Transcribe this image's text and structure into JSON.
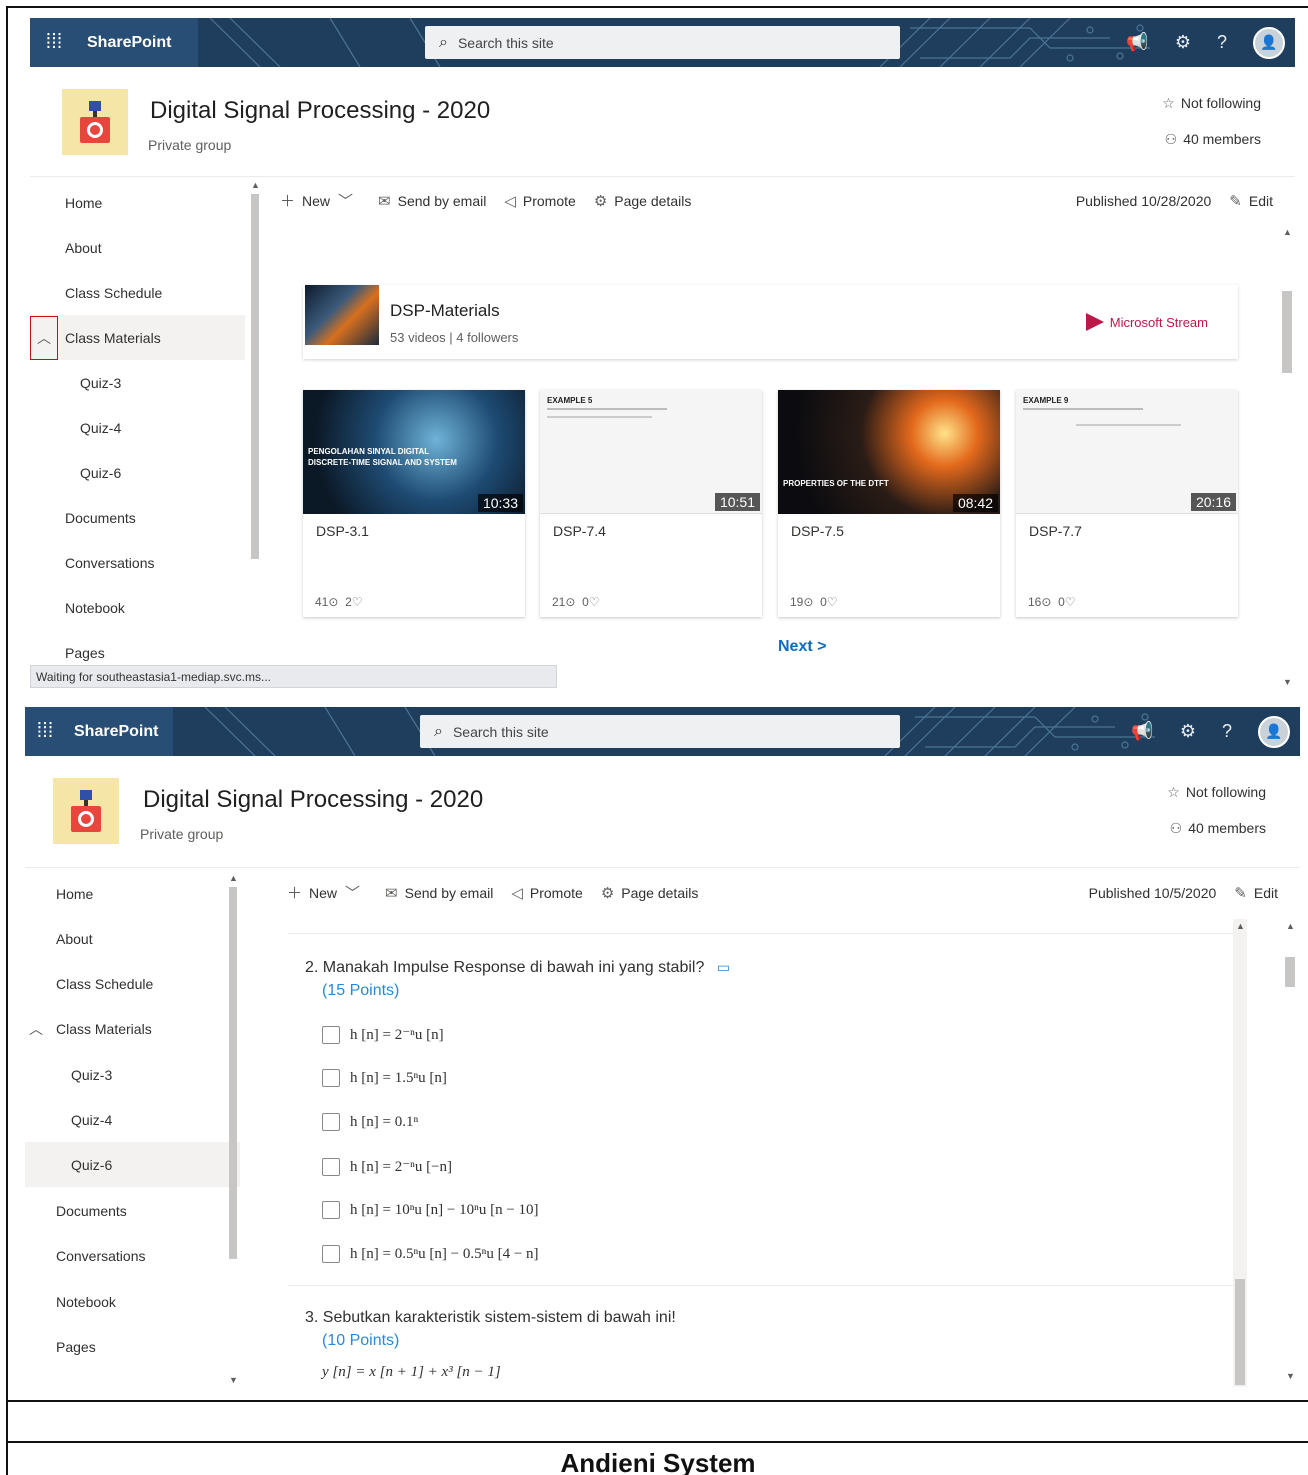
{
  "suite": {
    "brand": "SharePoint",
    "search_placeholder": "Search this site"
  },
  "site": {
    "title": "Digital Signal Processing - 2020",
    "subtitle": "Private group",
    "follow": "Not following",
    "members": "40 members"
  },
  "nav": {
    "home": "Home",
    "about": "About",
    "schedule": "Class Schedule",
    "materials": "Class Materials",
    "quiz3": "Quiz-3",
    "quiz4": "Quiz-4",
    "quiz6": "Quiz-6",
    "documents": "Documents",
    "conversations": "Conversations",
    "notebook": "Notebook",
    "pages": "Pages"
  },
  "cmd": {
    "new": "New",
    "send": "Send by email",
    "promote": "Promote",
    "details": "Page details",
    "edit": "Edit"
  },
  "screen1": {
    "published": "Published 10/28/2020",
    "stream": {
      "name": "DSP-Materials",
      "meta": "53 videos | 4 followers",
      "brand": "Microsoft Stream"
    },
    "videos": [
      {
        "title": "DSP-3.1",
        "duration": "10:33",
        "views": "41",
        "likes": "2",
        "thumb_text_1": "PENGOLAHAN SINYAL DIGITAL",
        "thumb_text_2": "DISCRETE-TIME SIGNAL AND SYSTEM"
      },
      {
        "title": "DSP-7.4",
        "duration": "10:51",
        "views": "21",
        "likes": "0",
        "thumb_text_1": "EXAMPLE 5"
      },
      {
        "title": "DSP-7.5",
        "duration": "08:42",
        "views": "19",
        "likes": "0",
        "thumb_text_1": "PROPERTIES OF THE DTFT"
      },
      {
        "title": "DSP-7.7",
        "duration": "20:16",
        "views": "16",
        "likes": "0",
        "thumb_text_1": "EXAMPLE 9"
      }
    ],
    "next": "Next >",
    "status": "Waiting for southeastasia1-mediap.svc.ms..."
  },
  "screen2": {
    "published": "Published 10/5/2020",
    "q2": {
      "title": "2. Manakah Impulse Response di bawah ini yang stabil?",
      "points": "(15 Points)",
      "options": [
        "h [n] = 2⁻ⁿu [n]",
        "h [n] = 1.5ⁿu [n]",
        "h [n] = 0.1ⁿ",
        "h [n] = 2⁻ⁿu [−n]",
        "h [n] = 10ⁿu [n] − 10ⁿu [n − 10]",
        "h [n] = 0.5ⁿu [n] − 0.5ⁿu [4 − n]"
      ]
    },
    "q3": {
      "title": "3. Sebutkan karakteristik sistem-sistem di bawah ini!",
      "points": "(10 Points)",
      "formula": "y [n] = x [n + 1] + x³ [n − 1]"
    }
  },
  "caption": "Andieni System",
  "colors": {
    "suitebar": "#1f3d5c",
    "accent_link": "#0f6cbd",
    "stream": "#bc1948",
    "points": "#2b88d8"
  }
}
